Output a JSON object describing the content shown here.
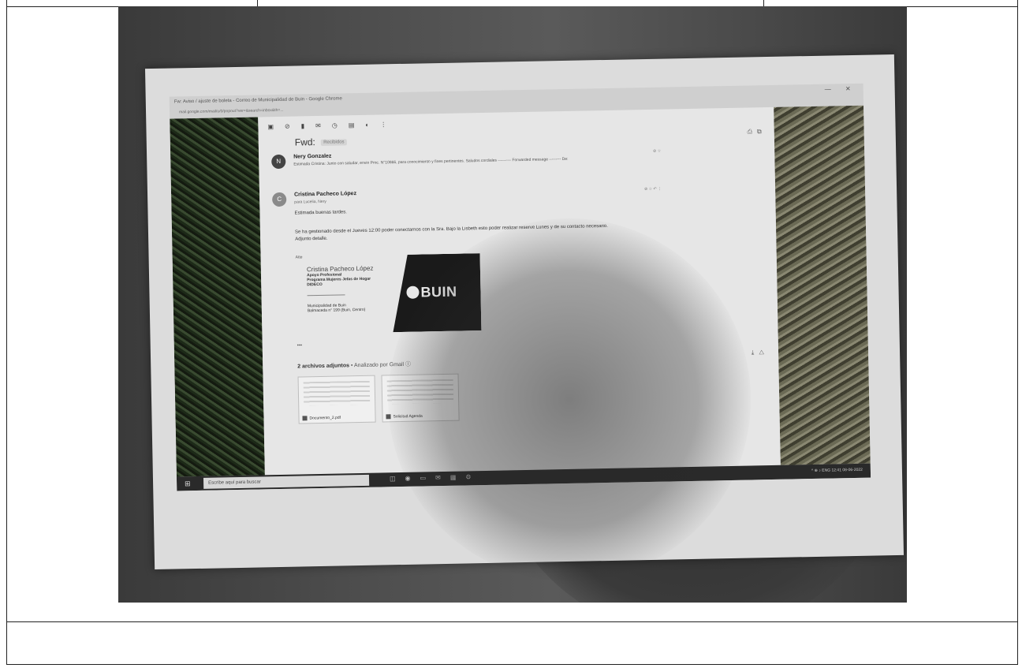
{
  "window": {
    "title": "Fw: Aviso / ajuste de boleta - Correo de Municipalidad de Buin - Google Chrome",
    "url": "mail.google.com/mail/u/0/popout?ver=&search=inbox&th=..."
  },
  "toolbar": {
    "icons": [
      "archive-icon",
      "report-icon",
      "delete-icon",
      "mail-icon",
      "clock-icon",
      "label-icon",
      "tag-icon",
      "more-icon"
    ]
  },
  "message": {
    "subject": "Fwd:",
    "subject_tag": "Recibidos",
    "first": {
      "avatar": "N",
      "sender": "Nery Gonzalez",
      "snippet": "Estimada Cristina: Junto con saludar, envio Proc. N°10866, para conocimiento y fines pertinentes. Saludos cordiales ---------- Forwarded message --------- De:"
    },
    "second": {
      "avatar": "C",
      "sender": "Cristina Pacheco López",
      "to": "para Lucelia, Nery",
      "greeting": "Estimada buenas tardes.",
      "body_1": "Se ha gestionado desde el Jueves 12:00 poder conectarnos con la Sra. Bajo la Lisbeth esto poder realizar reserve Lunes y de su contacto necesario.",
      "body_2": "Adjunto detalle.",
      "closing": "Atte"
    },
    "signature": {
      "name": "Cristina Pacheco López",
      "line1": "Apoyo Profesional",
      "line2": "Programa Mujeres Jefas de Hogar",
      "line3": "DIDECO",
      "addr1": "Municipalidad de Buin",
      "addr2": "Balmaceda n° 199 (Buin, Centro)"
    },
    "logo_text": "BUIN",
    "ellipsis": "•••"
  },
  "attachments": {
    "title": "2 archivos adjuntos",
    "subtitle": "• Analizado por Gmail ⓘ",
    "items": [
      {
        "name": "Documento_2.pdf"
      },
      {
        "name": "Solicitud Agenda"
      }
    ]
  },
  "taskbar": {
    "start": "⊞",
    "search_placeholder": "Escribe aquí para buscar",
    "tray": "^ ⊕ ♪ ENG 12:41 08-06-2022"
  }
}
